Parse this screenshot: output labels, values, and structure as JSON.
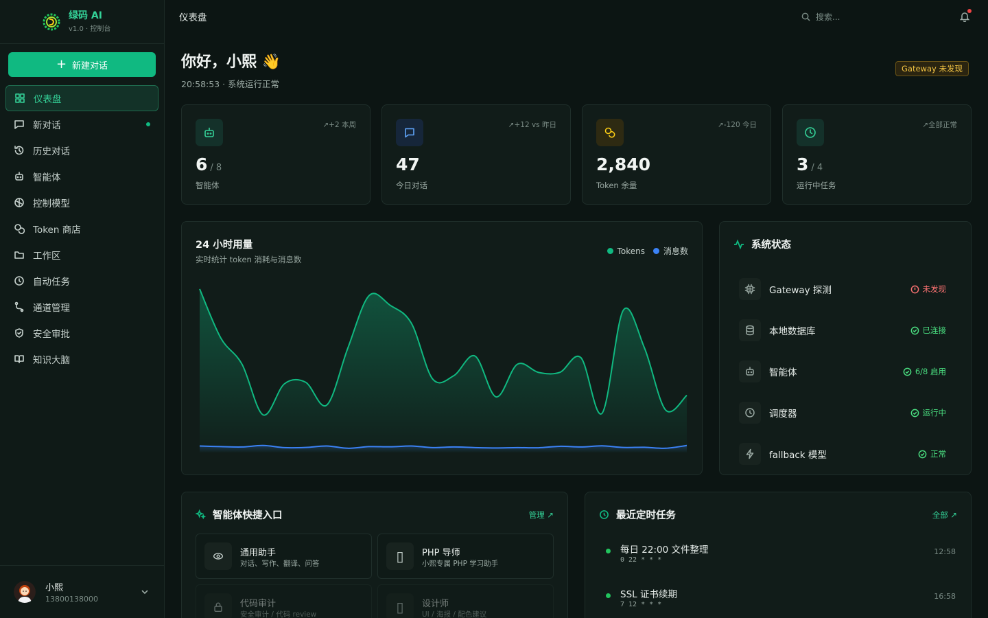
{
  "brand": {
    "name": "绿码 AI",
    "version": "v1.0 · 控制台"
  },
  "sidebar": {
    "new_chat": "新建对话",
    "items": [
      {
        "label": "仪表盘",
        "icon": "grid-icon",
        "active": true
      },
      {
        "label": "新对话",
        "icon": "message-icon",
        "dot": true
      },
      {
        "label": "历史对话",
        "icon": "history-icon"
      },
      {
        "label": "智能体",
        "icon": "robot-icon"
      },
      {
        "label": "控制模型",
        "icon": "brain-icon"
      },
      {
        "label": "Token 商店",
        "icon": "coins-icon"
      },
      {
        "label": "工作区",
        "icon": "folder-icon"
      },
      {
        "label": "自动任务",
        "icon": "clock-icon"
      },
      {
        "label": "通道管理",
        "icon": "route-icon"
      },
      {
        "label": "安全审批",
        "icon": "shield-icon"
      },
      {
        "label": "知识大脑",
        "icon": "book-icon"
      }
    ],
    "user": {
      "name": "小熙",
      "phone": "13800138000"
    }
  },
  "topbar": {
    "title": "仪表盘",
    "search_placeholder": "搜索..."
  },
  "greeting": {
    "title": "你好，小熙 ",
    "emoji": "👋",
    "subtitle": "20:58:53 · 系统运行正常"
  },
  "gateway_badge": "Gateway 未发现",
  "stats": [
    {
      "value": "6",
      "of": "/ 8",
      "label": "智能体",
      "trend": "+2 本周",
      "icon": "robot-icon",
      "color": "#34d399",
      "bg": "#14312a"
    },
    {
      "value": "47",
      "of": "",
      "label": "今日对话",
      "trend": "+12 vs 昨日",
      "icon": "message-icon",
      "color": "#60a5fa",
      "bg": "#16263a"
    },
    {
      "value": "2,840",
      "of": "",
      "label": "Token 余量",
      "trend": "-120 今日",
      "icon": "coins-icon",
      "color": "#facc15",
      "bg": "#2e2a12"
    },
    {
      "value": "3",
      "of": "/ 4",
      "label": "运行中任务",
      "trend": "全部正常",
      "icon": "clock-icon",
      "color": "#34d399",
      "bg": "#14312a"
    }
  ],
  "usage": {
    "title": "24 小时用量",
    "subtitle": "实时统计 token 消耗与消息数",
    "legend_tokens": "Tokens",
    "legend_messages": "消息数"
  },
  "chart_data": {
    "type": "area",
    "title": "24 小时用量",
    "subtitle": "实时统计 token 消耗与消息数",
    "x": [
      0,
      1,
      2,
      3,
      4,
      5,
      6,
      7,
      8,
      9,
      10,
      11,
      12,
      13,
      14,
      15,
      16,
      17,
      18,
      19,
      20,
      21,
      22,
      23
    ],
    "series": [
      {
        "name": "Tokens",
        "color": "#10b981",
        "values": [
          100,
          70,
          54,
          23,
          42,
          43,
          29,
          64,
          96,
          90,
          79,
          45,
          47,
          59,
          34,
          54,
          49,
          49,
          58,
          24,
          87,
          64,
          26,
          35
        ]
      },
      {
        "name": "消息数",
        "color": "#3b82f6",
        "values": [
          4,
          3.6,
          3.4,
          4.3,
          3,
          3.1,
          4,
          2.6,
          3.6,
          3.5,
          4,
          3,
          3.4,
          3,
          2.8,
          3,
          2.9,
          3.8,
          3.4,
          4.1,
          3.1,
          3.2,
          2.6,
          4.3
        ]
      }
    ],
    "ylim": [
      0,
      105
    ],
    "grid": false,
    "legend": "top-right"
  },
  "system_status": {
    "title": "系统状态",
    "rows": [
      {
        "name": "Gateway 探测",
        "state": "未发现",
        "ok": false,
        "icon": "chip-icon"
      },
      {
        "name": "本地数据库",
        "state": "已连接",
        "ok": true,
        "icon": "database-icon"
      },
      {
        "name": "智能体",
        "state": "6/8 启用",
        "ok": true,
        "icon": "robot-icon"
      },
      {
        "name": "调度器",
        "state": "运行中",
        "ok": true,
        "icon": "clock-icon"
      },
      {
        "name": "fallback 模型",
        "state": "正常",
        "ok": true,
        "icon": "bolt-icon"
      }
    ]
  },
  "quick": {
    "title": "智能体快捷入口",
    "link": "管理",
    "agents": [
      {
        "name": "通用助手",
        "desc": "对话、写作、翻译、问答",
        "icon": "eye-icon"
      },
      {
        "name": "PHP 导师",
        "desc": "小熙专属 PHP 学习助手",
        "icon": "book-glyph"
      },
      {
        "name": "代码审计",
        "desc": "安全审计 / 代码 review",
        "icon": "lock-icon"
      },
      {
        "name": "设计师",
        "desc": "UI / 海报 / 配色建议",
        "icon": "palette-glyph"
      }
    ]
  },
  "tasks": {
    "title": "最近定时任务",
    "link": "全部",
    "items": [
      {
        "name": "每日 22:00 文件整理",
        "cron": "0 22 * * *",
        "time": "12:58"
      },
      {
        "name": "SSL 证书续期",
        "cron": "7 12 * * *",
        "time": "16:58"
      }
    ]
  }
}
